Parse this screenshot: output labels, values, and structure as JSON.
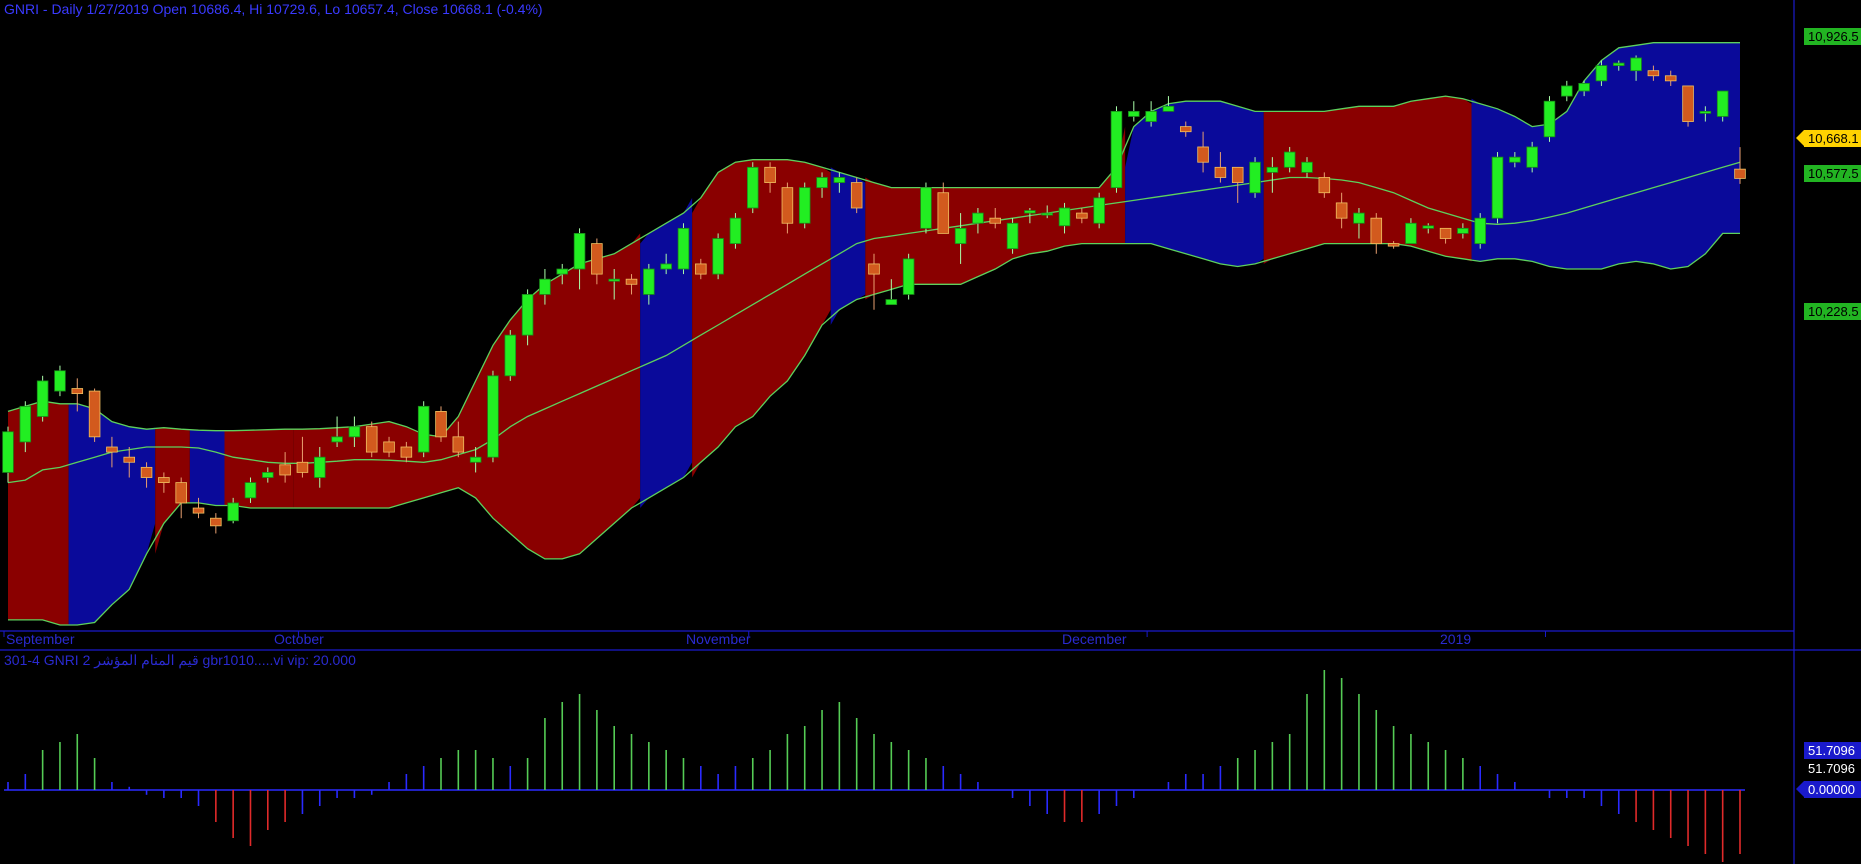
{
  "header": {
    "title": "GNRI - Daily 1/27/2019 Open 10686.4, Hi 10729.6, Lo 10657.4, Close 10668.1 (-0.4%)"
  },
  "indicator": {
    "title": "301-4  GNRI    قيم المنام المؤشر 2  gbr1010.....vi    vip:  20.000"
  },
  "axis": {
    "months": [
      "September",
      "October",
      "November",
      "December",
      "2019"
    ],
    "price_labels": [
      "10,926.5",
      "10,668.1",
      "10,577.5",
      "10,228.5"
    ],
    "indicator_labels": [
      "51.7096",
      "51.7096",
      "0.00000"
    ]
  },
  "colors": {
    "background": "#000000",
    "band_blue": "#0a0a9a",
    "band_red": "#8a0000",
    "band_line": "#5dd15d",
    "candle_up": "#22ee22",
    "candle_down": "#d25a1e",
    "axis_blue": "#1a1acc",
    "label_green": "#22b422",
    "label_yellow": "#ffd200",
    "osc_green": "#55cc55",
    "osc_blue": "#2a2aff",
    "osc_red": "#e02a2a"
  },
  "chart_data": {
    "type": "candlestick",
    "price_range": [
      9790,
      10960
    ],
    "ohlc": [
      [
        10090,
        10180,
        10070,
        10170
      ],
      [
        10150,
        10230,
        10130,
        10220
      ],
      [
        10200,
        10280,
        10190,
        10270
      ],
      [
        10250,
        10300,
        10240,
        10290
      ],
      [
        10255,
        10275,
        10210,
        10245
      ],
      [
        10250,
        10255,
        10150,
        10160
      ],
      [
        10140,
        10160,
        10100,
        10130
      ],
      [
        10120,
        10140,
        10080,
        10110
      ],
      [
        10100,
        10110,
        10060,
        10080
      ],
      [
        10080,
        10090,
        10050,
        10070
      ],
      [
        10070,
        10080,
        10000,
        10030
      ],
      [
        10020,
        10040,
        10000,
        10010
      ],
      [
        10000,
        10010,
        9970,
        9985
      ],
      [
        9995,
        10040,
        9990,
        10030
      ],
      [
        10040,
        10080,
        10030,
        10070
      ],
      [
        10080,
        10100,
        10070,
        10090
      ],
      [
        10105,
        10130,
        10070,
        10085
      ],
      [
        10110,
        10160,
        10080,
        10090
      ],
      [
        10080,
        10140,
        10060,
        10120
      ],
      [
        10150,
        10200,
        10140,
        10160
      ],
      [
        10160,
        10200,
        10140,
        10180
      ],
      [
        10180,
        10190,
        10120,
        10130
      ],
      [
        10150,
        10160,
        10120,
        10130
      ],
      [
        10140,
        10150,
        10110,
        10120
      ],
      [
        10130,
        10230,
        10120,
        10220
      ],
      [
        10210,
        10220,
        10150,
        10160
      ],
      [
        10160,
        10190,
        10120,
        10130
      ],
      [
        10110,
        10140,
        10090,
        10120
      ],
      [
        10120,
        10290,
        10110,
        10280
      ],
      [
        10280,
        10370,
        10270,
        10360
      ],
      [
        10360,
        10450,
        10340,
        10440
      ],
      [
        10440,
        10490,
        10420,
        10470
      ],
      [
        10480,
        10500,
        10460,
        10490
      ],
      [
        10490,
        10570,
        10450,
        10560
      ],
      [
        10540,
        10550,
        10460,
        10480
      ],
      [
        10470,
        10490,
        10430,
        10470
      ],
      [
        10470,
        10480,
        10440,
        10460
      ],
      [
        10440,
        10500,
        10420,
        10490
      ],
      [
        10490,
        10520,
        10480,
        10500
      ],
      [
        10490,
        10580,
        10480,
        10570
      ],
      [
        10500,
        10510,
        10470,
        10480
      ],
      [
        10480,
        10560,
        10470,
        10550
      ],
      [
        10540,
        10600,
        10530,
        10590
      ],
      [
        10610,
        10700,
        10600,
        10690
      ],
      [
        10690,
        10700,
        10640,
        10660
      ],
      [
        10650,
        10660,
        10560,
        10580
      ],
      [
        10580,
        10660,
        10570,
        10650
      ],
      [
        10650,
        10680,
        10630,
        10670
      ],
      [
        10660,
        10680,
        10640,
        10670
      ],
      [
        10660,
        10670,
        10600,
        10610
      ],
      [
        10500,
        10520,
        10410,
        10480
      ],
      [
        10420,
        10470,
        10420,
        10430
      ],
      [
        10440,
        10520,
        10430,
        10510
      ],
      [
        10570,
        10660,
        10560,
        10650
      ],
      [
        10640,
        10660,
        10560,
        10560
      ],
      [
        10540,
        10600,
        10500,
        10570
      ],
      [
        10580,
        10610,
        10560,
        10600
      ],
      [
        10590,
        10610,
        10570,
        10580
      ],
      [
        10530,
        10590,
        10520,
        10580
      ],
      [
        10600,
        10610,
        10580,
        10605
      ],
      [
        10600,
        10615,
        10590,
        10600
      ],
      [
        10575,
        10620,
        10560,
        10610
      ],
      [
        10600,
        10610,
        10580,
        10590
      ],
      [
        10580,
        10640,
        10570,
        10630
      ],
      [
        10650,
        10810,
        10640,
        10800
      ],
      [
        10790,
        10820,
        10780,
        10800
      ],
      [
        10780,
        10820,
        10770,
        10800
      ],
      [
        10800,
        10830,
        10800,
        10810
      ],
      [
        10770,
        10780,
        10750,
        10760
      ],
      [
        10730,
        10760,
        10680,
        10700
      ],
      [
        10690,
        10720,
        10660,
        10670
      ],
      [
        10690,
        10690,
        10620,
        10660
      ],
      [
        10640,
        10710,
        10630,
        10700
      ],
      [
        10680,
        10710,
        10640,
        10690
      ],
      [
        10690,
        10730,
        10680,
        10720
      ],
      [
        10680,
        10710,
        10670,
        10700
      ],
      [
        10670,
        10680,
        10630,
        10640
      ],
      [
        10620,
        10640,
        10570,
        10590
      ],
      [
        10580,
        10610,
        10550,
        10600
      ],
      [
        10590,
        10600,
        10520,
        10540
      ],
      [
        10540,
        10545,
        10530,
        10535
      ],
      [
        10540,
        10590,
        10540,
        10580
      ],
      [
        10570,
        10580,
        10560,
        10575
      ],
      [
        10570,
        10570,
        10540,
        10550
      ],
      [
        10560,
        10580,
        10550,
        10570
      ],
      [
        10540,
        10600,
        10530,
        10590
      ],
      [
        10590,
        10720,
        10580,
        10710
      ],
      [
        10700,
        10720,
        10690,
        10710
      ],
      [
        10690,
        10740,
        10680,
        10730
      ],
      [
        10750,
        10830,
        10740,
        10820
      ],
      [
        10830,
        10860,
        10820,
        10850
      ],
      [
        10840,
        10860,
        10830,
        10855
      ],
      [
        10860,
        10900,
        10850,
        10890
      ],
      [
        10890,
        10900,
        10880,
        10895
      ],
      [
        10880,
        10910,
        10860,
        10905
      ],
      [
        10880,
        10890,
        10860,
        10870
      ],
      [
        10870,
        10880,
        10850,
        10860
      ],
      [
        10850,
        10850,
        10770,
        10780
      ],
      [
        10800,
        10810,
        10780,
        10800
      ],
      [
        10790,
        10840,
        10780,
        10840
      ],
      [
        10686.4,
        10729.6,
        10657.4,
        10668.1
      ]
    ],
    "upper_band": [
      10210,
      10220,
      10230,
      10225,
      10225,
      10215,
      10190,
      10180,
      10175,
      10178,
      10175,
      10173,
      10172,
      10172,
      10173,
      10174,
      10175,
      10175,
      10176,
      10178,
      10180,
      10185,
      10190,
      10180,
      10165,
      10160,
      10200,
      10270,
      10340,
      10390,
      10430,
      10460,
      10480,
      10500,
      10510,
      10520,
      10540,
      10560,
      10580,
      10600,
      10630,
      10680,
      10700,
      10705,
      10705,
      10705,
      10700,
      10690,
      10680,
      10670,
      10660,
      10650,
      10650,
      10650,
      10650,
      10650,
      10650,
      10650,
      10650,
      10650,
      10650,
      10650,
      10650,
      10650,
      10690,
      10770,
      10800,
      10815,
      10820,
      10820,
      10820,
      10810,
      10800,
      10800,
      10800,
      10800,
      10800,
      10805,
      10810,
      10810,
      10810,
      10820,
      10825,
      10830,
      10825,
      10815,
      10805,
      10790,
      10770,
      10775,
      10800,
      10860,
      10900,
      10925,
      10930,
      10935,
      10935,
      10935,
      10935,
      10935,
      10935
    ],
    "lower_band": [
      9800,
      9800,
      9800,
      9790,
      9790,
      9795,
      9830,
      9860,
      9930,
      9990,
      10030,
      10030,
      10025,
      10025,
      10020,
      10020,
      10020,
      10020,
      10020,
      10020,
      10020,
      10020,
      10020,
      10030,
      10040,
      10050,
      10060,
      10040,
      10000,
      9970,
      9940,
      9920,
      9920,
      9930,
      9960,
      9990,
      10020,
      10040,
      10060,
      10080,
      10110,
      10140,
      10180,
      10200,
      10240,
      10270,
      10320,
      10380,
      10410,
      10430,
      10440,
      10450,
      10460,
      10460,
      10460,
      10460,
      10475,
      10490,
      10510,
      10520,
      10525,
      10535,
      10540,
      10540,
      10540,
      10540,
      10540,
      10530,
      10520,
      10510,
      10500,
      10495,
      10500,
      10510,
      10520,
      10530,
      10540,
      10540,
      10540,
      10540,
      10540,
      10535,
      10525,
      10515,
      10510,
      10505,
      10510,
      10510,
      10505,
      10495,
      10490,
      10490,
      10490,
      10500,
      10505,
      10500,
      10490,
      10495,
      10520,
      10560,
      10560
    ],
    "middle_band": [
      10070,
      10075,
      10095,
      10100,
      10110,
      10120,
      10130,
      10135,
      10140,
      10140,
      10140,
      10138,
      10130,
      10120,
      10115,
      10110,
      10108,
      10108,
      10110,
      10112,
      10115,
      10115,
      10114,
      10112,
      10110,
      10115,
      10125,
      10135,
      10155,
      10180,
      10200,
      10215,
      10230,
      10245,
      10260,
      10275,
      10290,
      10305,
      10320,
      10340,
      10360,
      10380,
      10400,
      10420,
      10440,
      10460,
      10480,
      10500,
      10520,
      10540,
      10550,
      10555,
      10560,
      10565,
      10570,
      10575,
      10580,
      10585,
      10590,
      10595,
      10600,
      10605,
      10610,
      10615,
      10620,
      10625,
      10630,
      10635,
      10640,
      10645,
      10650,
      10655,
      10660,
      10665,
      10670,
      10670,
      10668,
      10665,
      10660,
      10650,
      10640,
      10625,
      10610,
      10600,
      10590,
      10580,
      10578,
      10580,
      10585,
      10592,
      10600,
      10610,
      10620,
      10630,
      10640,
      10650,
      10660,
      10670,
      10680,
      10690,
      10700
    ],
    "band_regions": [
      {
        "from": 0,
        "to": 3,
        "color": "red"
      },
      {
        "from": 4,
        "to": 8,
        "color": "blue"
      },
      {
        "from": 9,
        "to": 10,
        "color": "red"
      },
      {
        "from": 11,
        "to": 12,
        "color": "blue"
      },
      {
        "from": 13,
        "to": 16,
        "color": "red"
      },
      {
        "from": 17,
        "to": 36,
        "color": "red"
      },
      {
        "from": 37,
        "to": 39,
        "color": "blue"
      },
      {
        "from": 40,
        "to": 47,
        "color": "red"
      },
      {
        "from": 48,
        "to": 49,
        "color": "blue"
      },
      {
        "from": 50,
        "to": 64,
        "color": "red"
      },
      {
        "from": 65,
        "to": 72,
        "color": "blue"
      },
      {
        "from": 73,
        "to": 84,
        "color": "red"
      },
      {
        "from": 85,
        "to": 101,
        "color": "blue"
      }
    ],
    "oscillator": [
      5,
      10,
      25,
      30,
      35,
      20,
      5,
      2,
      -3,
      -5,
      -5,
      -10,
      -20,
      -30,
      -35,
      -25,
      -20,
      -15,
      -10,
      -5,
      -5,
      -3,
      5,
      10,
      15,
      20,
      25,
      25,
      20,
      15,
      20,
      45,
      55,
      60,
      50,
      40,
      35,
      30,
      25,
      20,
      15,
      10,
      15,
      20,
      25,
      35,
      40,
      50,
      55,
      45,
      35,
      30,
      25,
      20,
      15,
      10,
      5,
      0,
      -5,
      -10,
      -15,
      -20,
      -20,
      -15,
      -10,
      -5,
      0,
      5,
      10,
      10,
      15,
      20,
      25,
      30,
      35,
      60,
      75,
      70,
      60,
      50,
      40,
      35,
      30,
      25,
      20,
      15,
      10,
      5,
      0,
      -5,
      -5,
      -5,
      -10,
      -15,
      -20,
      -25,
      -30,
      -35,
      -40,
      -45,
      -40
    ]
  }
}
